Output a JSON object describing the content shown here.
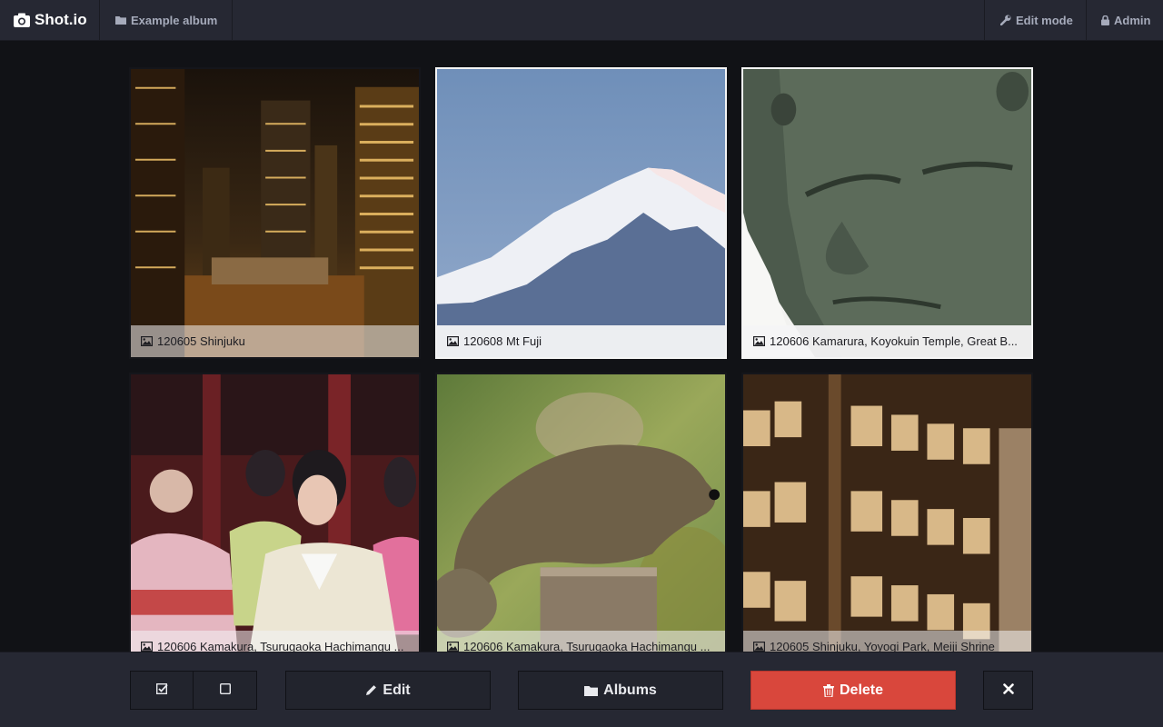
{
  "nav": {
    "brand": "Shot.io",
    "album": "Example album",
    "edit_mode": "Edit mode",
    "admin": "Admin"
  },
  "photos": [
    {
      "caption": "120605 Shinjuku",
      "selected": false
    },
    {
      "caption": "120608 Mt Fuji",
      "selected": true
    },
    {
      "caption": "120606 Kamarura, Koyokuin Temple, Great B...",
      "selected": true
    },
    {
      "caption": "120606 Kamakura, Tsurugaoka Hachimangu ...",
      "selected": false
    },
    {
      "caption": "120606 Kamakura, Tsurugaoka Hachimangu ...",
      "selected": false
    },
    {
      "caption": "120605 Shinjuku, Yoyogi Park, Meiji Shrine",
      "selected": false
    }
  ],
  "toolbar": {
    "edit": "Edit",
    "albums": "Albums",
    "delete": "Delete"
  },
  "colors": {
    "navbar": "#262833",
    "background": "#111216",
    "delete": "#d9473c"
  }
}
